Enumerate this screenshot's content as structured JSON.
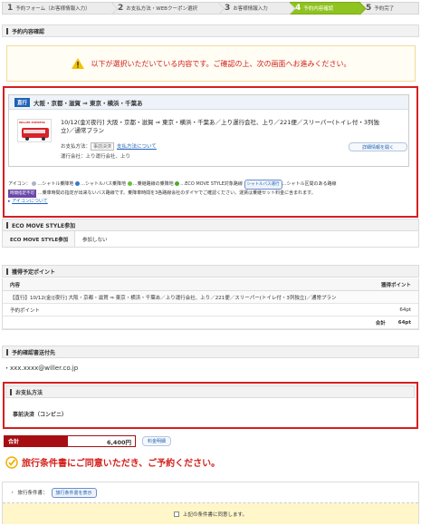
{
  "steps": [
    {
      "n": "1",
      "label": "予約フォーム（お客様情報入力）"
    },
    {
      "n": "2",
      "label": "お支払方法・WEBクーポン選択"
    },
    {
      "n": "3",
      "label": "お客様情報入力"
    },
    {
      "n": "4",
      "label": "予約内容確認"
    },
    {
      "n": "5",
      "label": "予約完了"
    }
  ],
  "active_step": "4",
  "section_reserve": "予約内容確認",
  "alert_text": "以下が選択いただいている内容です。ご確認の上、次の画面へお進みください。",
  "route": {
    "badge": "直行",
    "title": "大阪・京都・滋賀 ⇒ 東京・横浜・千葉あ",
    "trip": "10/12(金)[夜行] 大阪・京都・滋賀 ⇒ 東京・横浜・千葉あ／上り運行会社、上り／221便／スリーパー(トイレ付・3列独立)／通常プラン",
    "bus_brand": "WILLER EXPRESS",
    "payment_label": "お支払方法：",
    "payment_tag": "事前決済",
    "payment_link": "支払方法について",
    "operator": "運行会社：上り運行会社、上り",
    "detail_button": "詳細情報を開く"
  },
  "legend": {
    "label": "アイコン：",
    "items": [
      "…シャトル乗降地",
      "…シャトルバス乗降地",
      "…乗継路線の乗降地",
      "…ECO MOVE STYLE対象路線",
      "…シャトル区間のある路線"
    ],
    "shuttle_pill": "シャトルバス運行",
    "time_tag": "時間指定不可",
    "time_text": "…乗車時間の指定が出来ないバス路線です。乗降車時間を3各路線会社のダイヤでご確認ください。運賃は乗継セット料金に含まれます。",
    "about_link": "アイコンについて"
  },
  "eco": {
    "title": "ECO MOVE STYLE参加",
    "label": "ECO MOVE STYLE参加",
    "value": "参加しない"
  },
  "points": {
    "title": "獲得予定ポイント",
    "col_content": "内容",
    "col_points": "獲得ポイント",
    "item": "【直行】10/12(金)[夜行] 大阪・京都・滋賀 ⇒ 東京・横浜・千葉あ／上り運行会社、上り／221便／スリーパー(トイレ付・3列独立)／通常プラン",
    "sub_label": "予約ポイント",
    "sub_value": "64pt",
    "total_label": "合計",
    "total_value": "64pt"
  },
  "email": {
    "title": "予約確認書送付先",
    "value": "・xxx.xxxx@willer.co.jp"
  },
  "payment": {
    "title": "お支払方法",
    "value": "事前決済（コンビニ）"
  },
  "total": {
    "label": "合計",
    "value": "6,400円",
    "fare_button": "料金明細"
  },
  "agree_heading": "旅行条件書にご同意いただき、ご予約ください。",
  "conditions": {
    "label": "旅行条件書：",
    "button": "旅行条件書を表示",
    "checkbox": "上記の条件書に同意します。"
  },
  "colors": {
    "accent_red": "#d61f1f",
    "active_step": "#8fc31f",
    "total_red": "#a70e13",
    "link_blue": "#1e62b7"
  }
}
